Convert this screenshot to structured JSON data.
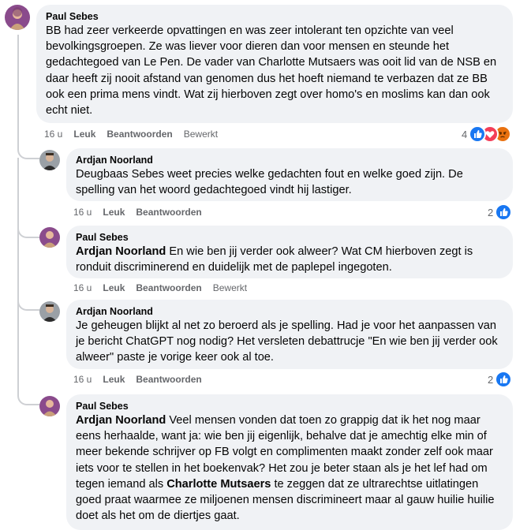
{
  "comments": [
    {
      "author": "Paul Sebes",
      "text": "BB had zeer verkeerde opvattingen en was zeer intolerant ten opzichte van veel bevolkingsgroepen. Ze was liever voor dieren dan voor mensen en steunde het gedachtegoed van Le Pen. De vader van Charlotte Mutsaers was ooit lid van de NSB en daar heeft zij nooit afstand van genomen dus het hoeft niemand te verbazen dat ze BB ook een prima mens vindt. Wat zij hierboven zegt over homo's en moslims kan dan ook echt niet.",
      "time": "16 u",
      "like": "Leuk",
      "reply": "Beantwoorden",
      "edited": "Bewerkt",
      "reaction_count": "4"
    },
    {
      "author": "Ardjan Noorland",
      "text": "Deugbaas Sebes weet precies welke gedachten fout en welke goed zijn. De spelling van het woord gedachtegoed vindt hij lastiger.",
      "time": "16 u",
      "like": "Leuk",
      "reply": "Beantwoorden",
      "reaction_count": "2"
    },
    {
      "author": "Paul Sebes",
      "mention": "Ardjan Noorland",
      "text": " En wie ben jij verder ook alweer? Wat CM hierboven zegt is ronduit discriminerend en duidelijk met de paplepel ingegoten.",
      "time": "16 u",
      "like": "Leuk",
      "reply": "Beantwoorden",
      "edited": "Bewerkt"
    },
    {
      "author": "Ardjan Noorland",
      "text": "Je geheugen blijkt al net zo beroerd als je spelling. Had je voor het aanpassen van je bericht ChatGPT nog nodig? Het versleten debattrucje \"En wie ben jij verder ook alweer\" paste je vorige keer ook al toe.",
      "time": "16 u",
      "like": "Leuk",
      "reply": "Beantwoorden",
      "reaction_count": "2"
    },
    {
      "author": "Paul Sebes",
      "mention": "Ardjan Noorland",
      "text_a": " Veel mensen vonden dat toen zo grappig dat ik het nog maar eens herhaalde, want ja: wie ben jij eigenlijk, behalve dat je amechtig elke min of meer bekende schrijver op FB volgt en complimenten maakt zonder zelf ook maar iets voor te stellen in het boekenvak? Het zou je beter staan als je het lef had om tegen iemand als ",
      "mention2": "Charlotte Mutsaers",
      "text_b": " te zeggen dat ze ultrarechtse uitlatingen goed praat waarmee ze miljoenen mensen discrimineert maar al gauw huilie huilie doet als het om de diertjes gaat."
    }
  ],
  "colors": {
    "bubble": "#f0f2f5",
    "secondary_text": "#65676b",
    "like_blue": "#1877f2",
    "love_red": "#f33e58",
    "angry_orange": "#e9710f"
  },
  "icons": [
    "like-icon",
    "love-icon",
    "angry-icon"
  ]
}
